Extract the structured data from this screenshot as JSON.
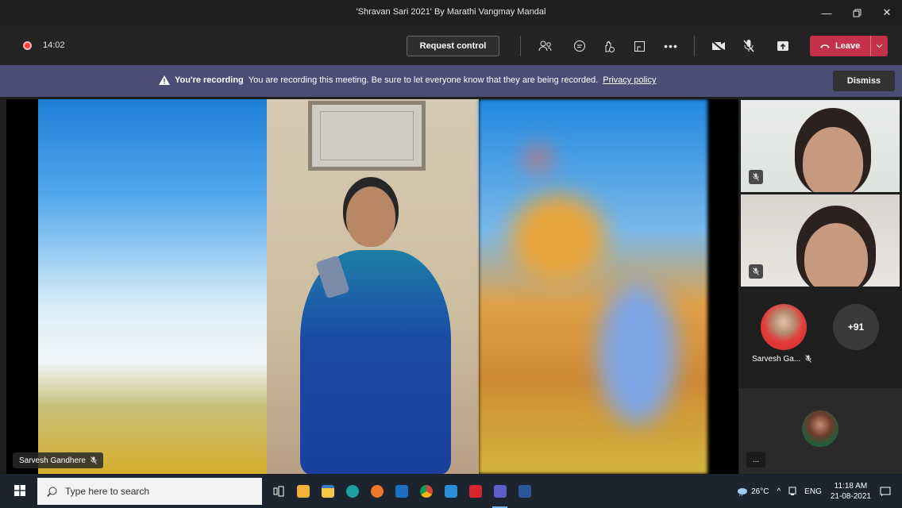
{
  "window": {
    "title": "'Shravan Sari 2021' By Marathi Vangmay Mandal",
    "controls": [
      "minimize-icon",
      "restore-icon",
      "close-icon"
    ]
  },
  "toolbar": {
    "timer": "14:02",
    "request_control_label": "Request control",
    "icons": [
      "participants-icon",
      "chat-icon",
      "reactions-icon",
      "rooms-icon",
      "more-icon",
      "camera-off-icon",
      "mic-off-icon",
      "share-icon"
    ],
    "leave_label": "Leave"
  },
  "banner": {
    "title": "You're recording",
    "message": "You are recording this meeting. Be sure to let everyone know that they are being recorded.",
    "link": "Privacy policy",
    "dismiss_label": "Dismiss",
    "bg_color": "#4c4d76"
  },
  "main_video": {
    "speaker_name": "Sarvesh Gandhere"
  },
  "side_panel": {
    "avatar_name": "Sarvesh Ga...",
    "overflow_count": "+91",
    "more_label": "..."
  },
  "taskbar": {
    "search_placeholder": "Type here to search",
    "temperature": "26°C",
    "language": "ENG",
    "time": "11:18 AM",
    "date": "21-08-2021"
  }
}
